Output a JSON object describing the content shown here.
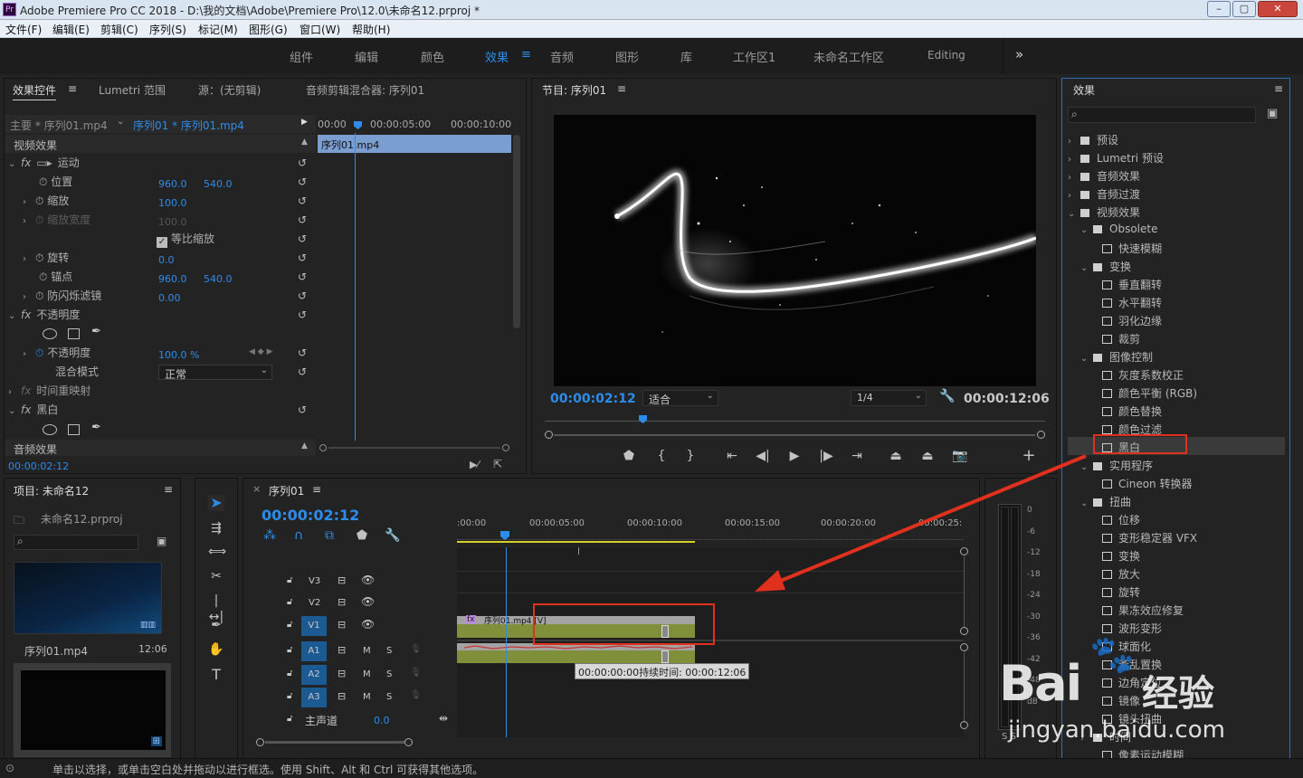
{
  "window": {
    "title": "Adobe Premiere Pro CC 2018 - D:\\我的文档\\Adobe\\Premiere Pro\\12.0\\未命名12.prproj *",
    "app_icon": "Pr"
  },
  "menubar": [
    "文件(F)",
    "编辑(E)",
    "剪辑(C)",
    "序列(S)",
    "标记(M)",
    "图形(G)",
    "窗口(W)",
    "帮助(H)"
  ],
  "workspaces": [
    "组件",
    "编辑",
    "颜色",
    "效果",
    "音频",
    "图形",
    "库",
    "工作区1",
    "未命名工作区",
    "Editing"
  ],
  "workspaces_more": "»",
  "effect_controls": {
    "tabs": [
      "效果控件",
      "Lumetri 范围",
      "源：(无剪辑)",
      "音频剪辑混合器: 序列01"
    ],
    "master": "主要 * 序列01.mp4",
    "clip": "序列01 * 序列01.mp4",
    "ruler": [
      "00:00",
      "00:00:05:00",
      "00:00:10:00"
    ],
    "clip_bar": "序列01.mp4",
    "video_effects": "视频效果",
    "motion": "运动",
    "position": {
      "label": "位置",
      "x": "960.0",
      "y": "540.0"
    },
    "scale": {
      "label": "缩放",
      "value": "100.0"
    },
    "scale_width": {
      "label": "缩放宽度",
      "value": "100.0"
    },
    "uniform": "等比缩放",
    "rotation": {
      "label": "旋转",
      "value": "0.0"
    },
    "anchor": {
      "label": "锚点",
      "x": "960.0",
      "y": "540.0"
    },
    "antiflicker": {
      "label": "防闪烁滤镜",
      "value": "0.00"
    },
    "opacity_group": "不透明度",
    "opacity": {
      "label": "不透明度",
      "value": "100.0 %"
    },
    "blend": {
      "label": "混合模式",
      "value": "正常"
    },
    "time_remap": "时间重映射",
    "bw": "黑白",
    "audio_effects": "音频效果",
    "timecode": "00:00:02:12"
  },
  "program": {
    "title": "节目: 序列01",
    "timecode": "00:00:02:12",
    "fit": "适合",
    "res": "1/4",
    "duration": "00:00:12:06"
  },
  "effects": {
    "title": "效果",
    "items": [
      {
        "label": "预设",
        "level": 0,
        "kind": "folder",
        "open": false
      },
      {
        "label": "Lumetri 预设",
        "level": 0,
        "kind": "folder",
        "open": false
      },
      {
        "label": "音频效果",
        "level": 0,
        "kind": "folder",
        "open": false
      },
      {
        "label": "音频过渡",
        "level": 0,
        "kind": "folder",
        "open": false
      },
      {
        "label": "视频效果",
        "level": 0,
        "kind": "folder",
        "open": true
      },
      {
        "label": "Obsolete",
        "level": 1,
        "kind": "folder",
        "open": true
      },
      {
        "label": "快速模糊",
        "level": 2,
        "kind": "effect"
      },
      {
        "label": "变换",
        "level": 1,
        "kind": "folder",
        "open": true
      },
      {
        "label": "垂直翻转",
        "level": 2,
        "kind": "effect"
      },
      {
        "label": "水平翻转",
        "level": 2,
        "kind": "effect"
      },
      {
        "label": "羽化边缘",
        "level": 2,
        "kind": "effect"
      },
      {
        "label": "裁剪",
        "level": 2,
        "kind": "effect"
      },
      {
        "label": "图像控制",
        "level": 1,
        "kind": "folder",
        "open": true
      },
      {
        "label": "灰度系数校正",
        "level": 2,
        "kind": "effect"
      },
      {
        "label": "颜色平衡 (RGB)",
        "level": 2,
        "kind": "effect"
      },
      {
        "label": "颜色替换",
        "level": 2,
        "kind": "effect"
      },
      {
        "label": "颜色过滤",
        "level": 2,
        "kind": "effect"
      },
      {
        "label": "黑白",
        "level": 2,
        "kind": "effect",
        "selected": true
      },
      {
        "label": "实用程序",
        "level": 1,
        "kind": "folder",
        "open": true
      },
      {
        "label": "Cineon 转换器",
        "level": 2,
        "kind": "effect"
      },
      {
        "label": "扭曲",
        "level": 1,
        "kind": "folder",
        "open": true
      },
      {
        "label": "位移",
        "level": 2,
        "kind": "effect"
      },
      {
        "label": "变形稳定器 VFX",
        "level": 2,
        "kind": "effect"
      },
      {
        "label": "变换",
        "level": 2,
        "kind": "effect"
      },
      {
        "label": "放大",
        "level": 2,
        "kind": "effect"
      },
      {
        "label": "旋转",
        "level": 2,
        "kind": "effect"
      },
      {
        "label": "果冻效应修复",
        "level": 2,
        "kind": "effect"
      },
      {
        "label": "波形变形",
        "level": 2,
        "kind": "effect"
      },
      {
        "label": "球面化",
        "level": 2,
        "kind": "effect"
      },
      {
        "label": "紊乱置换",
        "level": 2,
        "kind": "effect"
      },
      {
        "label": "边角定位",
        "level": 2,
        "kind": "effect"
      },
      {
        "label": "镜像",
        "level": 2,
        "kind": "effect"
      },
      {
        "label": "镜头扭曲",
        "level": 2,
        "kind": "effect"
      },
      {
        "label": "时间",
        "level": 1,
        "kind": "folder",
        "open": false
      },
      {
        "label": "像素运动模糊",
        "level": 2,
        "kind": "effect"
      }
    ]
  },
  "project": {
    "title": "项目: 未命名12",
    "file": "未命名12.prproj",
    "item1": "序列01.mp4",
    "item1_dur": "12:06"
  },
  "timeline": {
    "title": "序列01",
    "timecode": "00:00:02:12",
    "ruler": [
      ":00:00",
      "00:00:05:00",
      "00:00:10:00",
      "00:00:15:00",
      "00:00:20:00",
      "00:00:25:"
    ],
    "video_tracks": [
      "V3",
      "V2",
      "V1"
    ],
    "audio_tracks": [
      "A1",
      "A2",
      "A3"
    ],
    "master": "主声道",
    "master_val": "0.0",
    "clip_label": "序列01.mp4 [V]",
    "tooltip": "00:00:00:00持续时间: 00:00:12:06"
  },
  "meter_ticks": [
    "0",
    "-6",
    "-12",
    "-18",
    "-24",
    "-30",
    "-36",
    "-42",
    "-48",
    "dB"
  ],
  "status": "单击以选择，或单击空白处并拖动以进行框选。使用 Shift、Alt 和 Ctrl 可获得其他选项。",
  "watermark": {
    "brand": "Bai",
    "brand2": "经验",
    "url": "jingyan.baidu.com"
  },
  "colors": {
    "accent": "#2d8ceb",
    "highlight": "#e0301e",
    "clip_green": "#7f8f3a",
    "clip_header": "#a3a3a3"
  }
}
